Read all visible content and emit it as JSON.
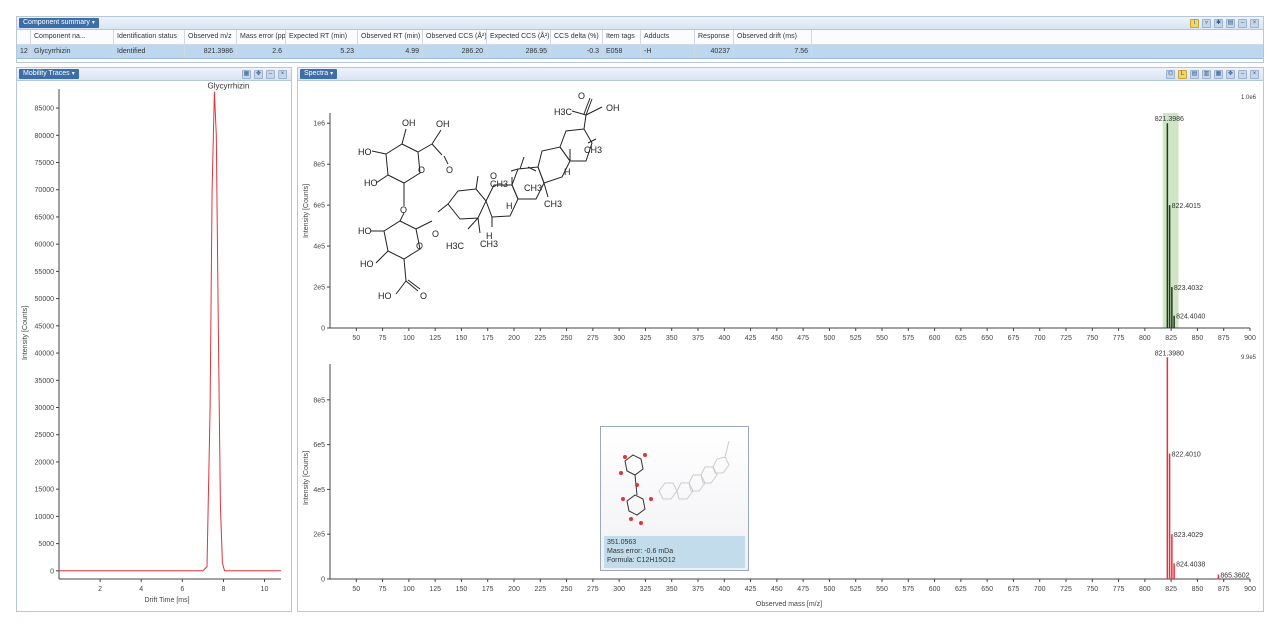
{
  "summary": {
    "title": "Component summary",
    "columns": [
      "Component na...",
      "Identification status",
      "Observed m/z",
      "Mass error (ppm)",
      "Expected RT (min)",
      "Observed RT (min)",
      "Observed CCS (Å²)",
      "Expected CCS (Å²)",
      "CCS delta (%)",
      "Item tags",
      "Adducts",
      "Response",
      "Observed drift (ms)"
    ],
    "row": {
      "index": "12",
      "name": "Glycyrrhizin",
      "status": "Identified",
      "mz": "821.3986",
      "mass_error": "2.6",
      "expected_rt": "5.23",
      "observed_rt": "4.99",
      "observed_ccs": "286.20",
      "expected_ccs": "286.95",
      "ccs_delta": "-0.3",
      "tags": "E058",
      "adducts": "-H",
      "response": "40237",
      "drift": "7.56"
    }
  },
  "mobility": {
    "title": "Mobility Traces",
    "peak_label": "Glycyrrhizin",
    "xlabel": "Drift Time [ms]",
    "ylabel": "Intensity [Counts]"
  },
  "spectra": {
    "title": "Spectra",
    "top_ylabel": "Intensity [Counts]",
    "bottom_ylabel": "Intensity [Counts]",
    "xlabel": "Observed mass [m/z]",
    "top_corner": "1.0e6",
    "bottom_corner": "9.9e5",
    "tooltip": {
      "line1": "351.0563",
      "line2": "Mass error: -0.6 mDa",
      "line3": "Formula: C12H15O12"
    }
  },
  "structure_labels": {
    "oh": "OH",
    "ho": "HO",
    "o": "O",
    "h": "H",
    "ch3": "CH3",
    "h3c": "H3C",
    "carboxyl_oh": "OH"
  },
  "colors": {
    "accent": "#3d6ea8",
    "mobility_trace": "#e0333a",
    "spectrum_top": "#1d3b1d",
    "highlight_band": "#cfe5c4",
    "spectrum_bottom": "#e0333a"
  },
  "chart_data": [
    {
      "type": "line",
      "title": "Mobility Traces",
      "xlabel": "Drift Time [ms]",
      "ylabel": "Intensity [Counts]",
      "xlim": [
        0,
        10.8
      ],
      "ylim": [
        -1500,
        88500
      ],
      "x_ticks": [
        2,
        4,
        6,
        8,
        10
      ],
      "y_ticks": [
        0,
        5000,
        10000,
        15000,
        20000,
        25000,
        30000,
        35000,
        40000,
        45000,
        50000,
        55000,
        60000,
        65000,
        70000,
        75000,
        80000,
        85000
      ],
      "series": [
        {
          "name": "Glycyrrhizin",
          "x": [
            0,
            2.0,
            7.0,
            7.2,
            7.35,
            7.45,
            7.56,
            7.65,
            7.75,
            7.85,
            7.95,
            8.05,
            10.8
          ],
          "y": [
            0,
            0,
            0,
            800,
            30000,
            70000,
            88000,
            80000,
            45000,
            12000,
            1500,
            0,
            0
          ]
        }
      ],
      "annotations": [
        {
          "x": 7.56,
          "y": 88000,
          "text": "Glycyrrhizin"
        }
      ]
    },
    {
      "type": "bar",
      "title": "Spectra (upper)",
      "ylabel": "Intensity [Counts]",
      "xlim": [
        25,
        900
      ],
      "ylim": [
        0,
        1050000
      ],
      "x_ticks": [
        50,
        75,
        100,
        125,
        150,
        175,
        200,
        225,
        250,
        275,
        300,
        325,
        350,
        375,
        400,
        425,
        450,
        475,
        500,
        525,
        550,
        575,
        600,
        625,
        650,
        675,
        700,
        725,
        750,
        775,
        800,
        825,
        850,
        875,
        900
      ],
      "y_ticks": [
        0,
        200000,
        400000,
        600000,
        800000,
        1000000
      ],
      "y_tick_labels": [
        "0",
        "2e5",
        "4e5",
        "6e5",
        "8e5",
        "1e6"
      ],
      "highlight_range": [
        817,
        832
      ],
      "peaks": [
        {
          "mz": 821.3986,
          "intensity": 1000000,
          "label": "821.3986"
        },
        {
          "mz": 822.4015,
          "intensity": 600000,
          "label": "822.4015"
        },
        {
          "mz": 823.4032,
          "intensity": 200000,
          "label": "823.4032"
        },
        {
          "mz": 824.404,
          "intensity": 60000,
          "label": "824.4040"
        }
      ]
    },
    {
      "type": "bar",
      "title": "Spectra (lower)",
      "xlabel": "Observed mass [m/z]",
      "ylabel": "Intensity [Counts]",
      "xlim": [
        25,
        900
      ],
      "ylim": [
        0,
        960000
      ],
      "x_ticks": [
        50,
        75,
        100,
        125,
        150,
        175,
        200,
        225,
        250,
        275,
        300,
        325,
        350,
        375,
        400,
        425,
        450,
        475,
        500,
        525,
        550,
        575,
        600,
        625,
        650,
        675,
        700,
        725,
        750,
        775,
        800,
        825,
        850,
        875,
        900
      ],
      "y_ticks": [
        0,
        200000,
        400000,
        600000,
        800000
      ],
      "y_tick_labels": [
        "0",
        "2e5",
        "4e5",
        "6e5",
        "8e5"
      ],
      "peaks": [
        {
          "mz": 821.398,
          "intensity": 990000,
          "label": "821.3980"
        },
        {
          "mz": 822.401,
          "intensity": 560000,
          "label": "822.4010"
        },
        {
          "mz": 823.4029,
          "intensity": 200000,
          "label": "823.4029"
        },
        {
          "mz": 824.4038,
          "intensity": 70000,
          "label": "824.4038"
        },
        {
          "mz": 865.3602,
          "intensity": 20000,
          "label": "865.3602"
        }
      ]
    }
  ]
}
